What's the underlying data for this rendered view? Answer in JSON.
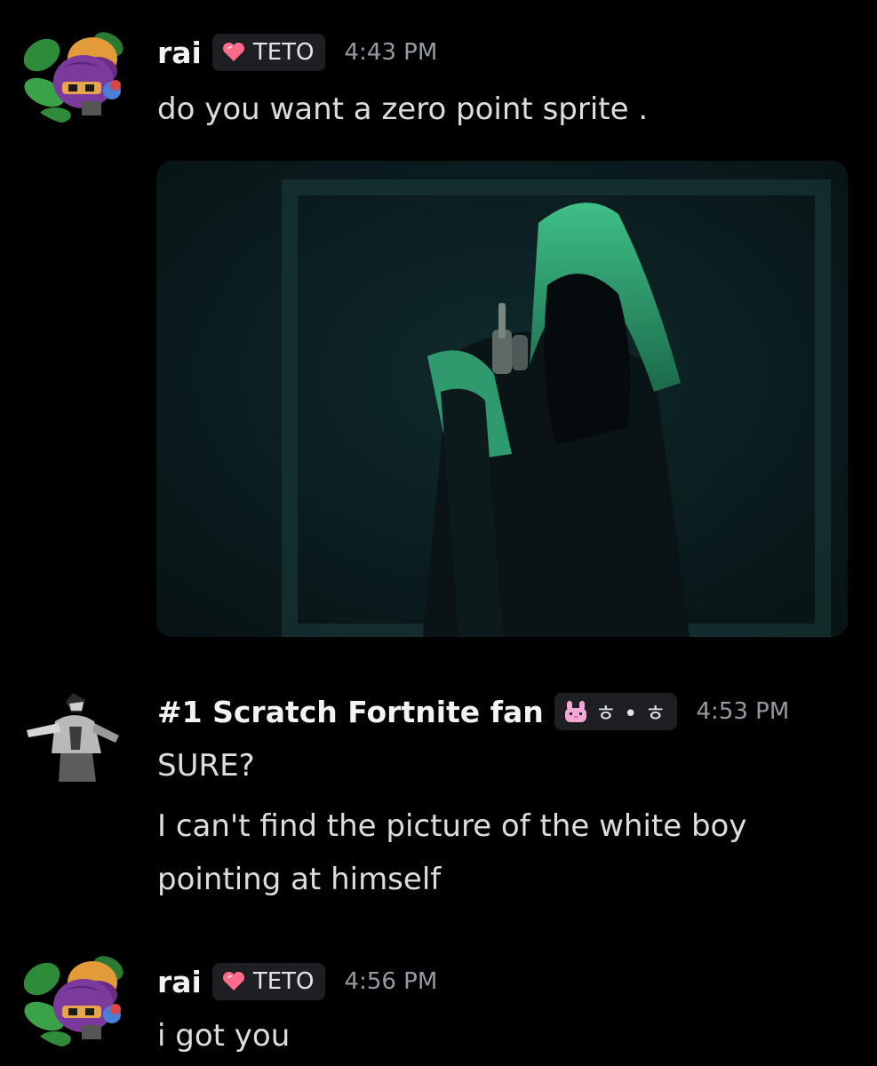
{
  "messages": [
    {
      "author": "rai",
      "tag": "TETO",
      "timestamp": "4:43 PM",
      "lines": [
        "do you want a zero point sprite ."
      ],
      "avatar_icon": "plant-creature-avatar",
      "attachment_icon": "hooded-figure-pointing-image"
    },
    {
      "author": "#1 Scratch Fortnite fan",
      "tag": "ㅎ • ㅎ",
      "timestamp": "4:53 PM",
      "lines": [
        "SURE?",
        "I can't find the picture of the white boy",
        "pointing at himself"
      ],
      "avatar_icon": "armored-figure-avatar"
    },
    {
      "author": "rai",
      "tag": "TETO",
      "timestamp": "4:56 PM",
      "lines": [
        "i got you"
      ],
      "avatar_icon": "plant-creature-avatar"
    }
  ],
  "colors": {
    "background": "#000000",
    "username": "#f2f3f5",
    "message_text": "#dbdee1",
    "timestamp": "#949ba4",
    "tag_background": "#1e1f22",
    "heart": "#ff6b8a"
  }
}
